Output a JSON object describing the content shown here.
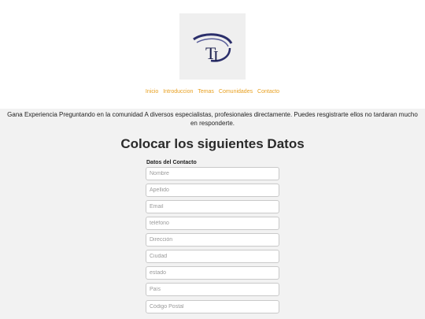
{
  "header": {
    "logo_icon": "ti-logo-icon",
    "brand_color": "#2b2f6b"
  },
  "nav": {
    "link_color": "#e8a020",
    "items": [
      "Inicio",
      "Introduccion",
      "Temas",
      "Comunidades",
      "Contacto"
    ]
  },
  "intro": {
    "text": "Gana Experiencia Preguntando en la comunidad A diversos especialistas, profesionales directamente. Puedes resgistrarte ellos no tardaran mucho en responderte."
  },
  "form": {
    "title": "Colocar los siguientes Datos",
    "section_label": "Datos del Contacto",
    "fields": [
      {
        "placeholder": "Nombre"
      },
      {
        "placeholder": "Apellido"
      },
      {
        "placeholder": "Email"
      },
      {
        "placeholder": "teléfono"
      },
      {
        "placeholder": "Dirección"
      },
      {
        "placeholder": "Ciudad"
      },
      {
        "placeholder": "estado"
      },
      {
        "placeholder": "País"
      },
      {
        "placeholder": "Código Postal"
      }
    ]
  }
}
